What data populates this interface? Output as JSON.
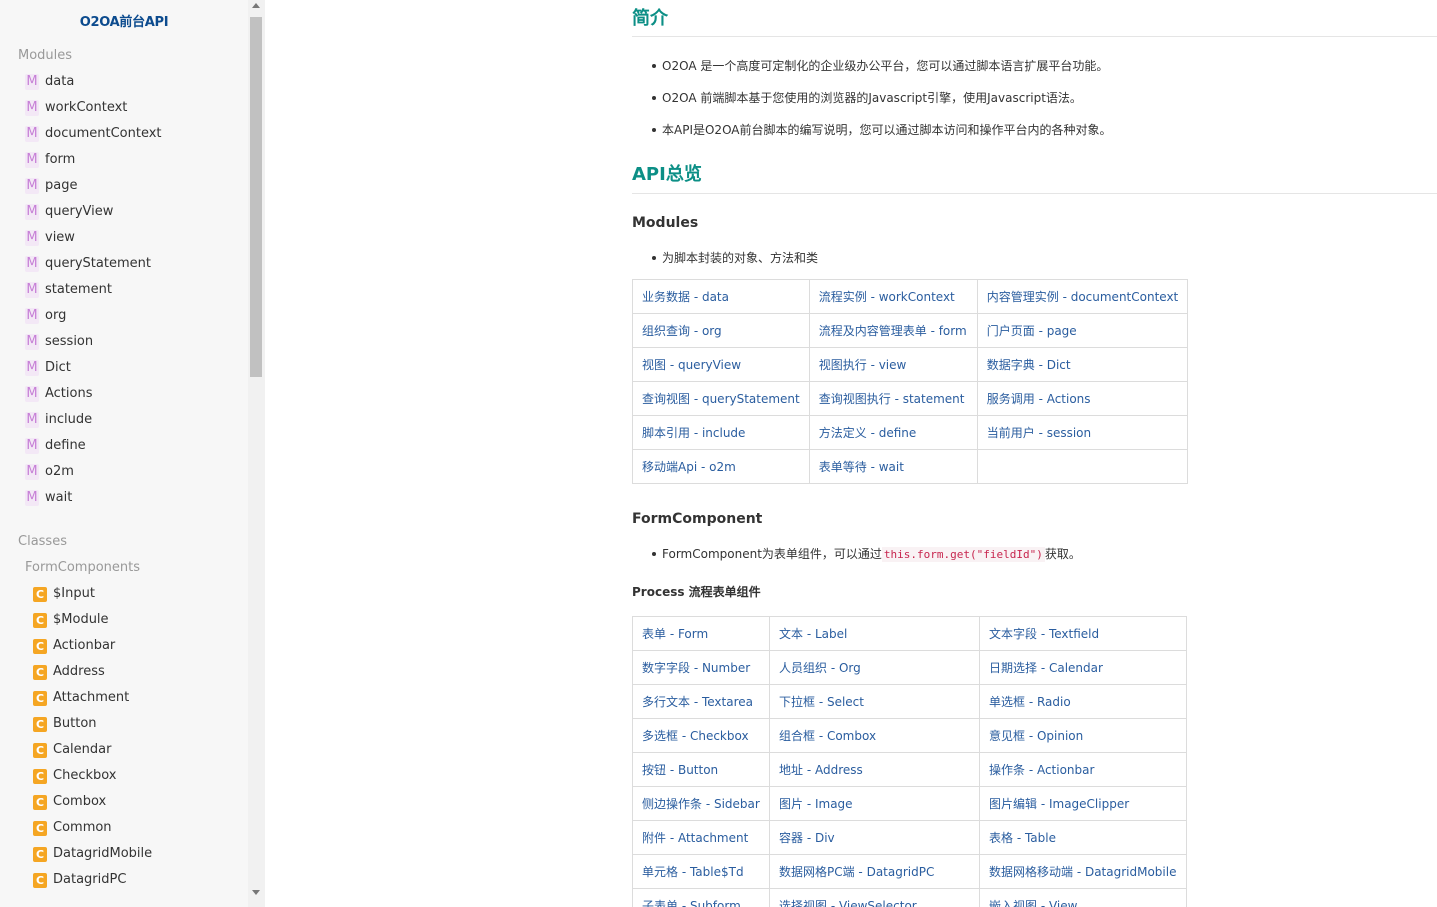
{
  "sidebar": {
    "title": "O2OA前台API",
    "modules_label": "Modules",
    "module_badge": "M",
    "modules": [
      "data",
      "workContext",
      "documentContext",
      "form",
      "page",
      "queryView",
      "view",
      "queryStatement",
      "statement",
      "org",
      "session",
      "Dict",
      "Actions",
      "include",
      "define",
      "o2m",
      "wait"
    ],
    "classes_label": "Classes",
    "class_badge": "C",
    "classes_group": "FormComponents",
    "classes": [
      "$Input",
      "$Module",
      "Actionbar",
      "Address",
      "Attachment",
      "Button",
      "Calendar",
      "Checkbox",
      "Combox",
      "Common",
      "DatagridMobile",
      "DatagridPC"
    ]
  },
  "main": {
    "intro_heading": "简介",
    "intro_bullets": [
      "O2OA 是一个高度可定制化的企业级办公平台，您可以通过脚本语言扩展平台功能。",
      "O2OA 前端脚本基于您使用的浏览器的Javascript引擎，使用Javascript语法。",
      "本API是O2OA前台脚本的编写说明，您可以通过脚本访问和操作平台内的各种对象。"
    ],
    "api_heading": "API总览",
    "modules_heading": "Modules",
    "modules_desc": "为脚本封装的对象、方法和类",
    "modules_table": [
      [
        "业务数据 - data",
        "流程实例 - workContext",
        "内容管理实例 - documentContext"
      ],
      [
        "组织查询 - org",
        "流程及内容管理表单 - form",
        "门户页面 - page"
      ],
      [
        "视图 - queryView",
        "视图执行 - view",
        "数据字典 - Dict"
      ],
      [
        "查询视图 - queryStatement",
        "查询视图执行 - statement",
        "服务调用 - Actions"
      ],
      [
        "脚本引用 - include",
        "方法定义 - define",
        "当前用户 - session"
      ],
      [
        "移动端Api - o2m",
        "表单等待 - wait",
        ""
      ]
    ],
    "formcomp_heading": "FormComponent",
    "formcomp_desc_pre": "FormComponent为表单组件，可以通过",
    "formcomp_code": "this.form.get(\"fieldId\")",
    "formcomp_desc_post": "获取。",
    "process_heading": "Process 流程表单组件",
    "process_table": [
      [
        "表单 - Form",
        "文本 - Label",
        "文本字段 - Textfield"
      ],
      [
        "数字字段 - Number",
        "人员组织 - Org",
        "日期选择 - Calendar"
      ],
      [
        "多行文本 - Textarea",
        "下拉框 - Select",
        "单选框 - Radio"
      ],
      [
        "多选框 - Checkbox",
        "组合框 - Combox",
        "意见框 - Opinion"
      ],
      [
        "按钮 - Button",
        "地址 - Address",
        "操作条 - Actionbar"
      ],
      [
        "侧边操作条 - Sidebar",
        "图片 - Image",
        "图片编辑 - ImageClipper"
      ],
      [
        "附件 - Attachment",
        "容器 - Div",
        "表格 - Table"
      ],
      [
        "单元格 - Table$Td",
        "数据网格PC端 - DatagridPC",
        "数据网格移动端 - DatagridMobile"
      ],
      [
        "子表单 - Subform",
        "选择视图 - ViewSelector",
        "嵌入视图 - View"
      ]
    ]
  }
}
